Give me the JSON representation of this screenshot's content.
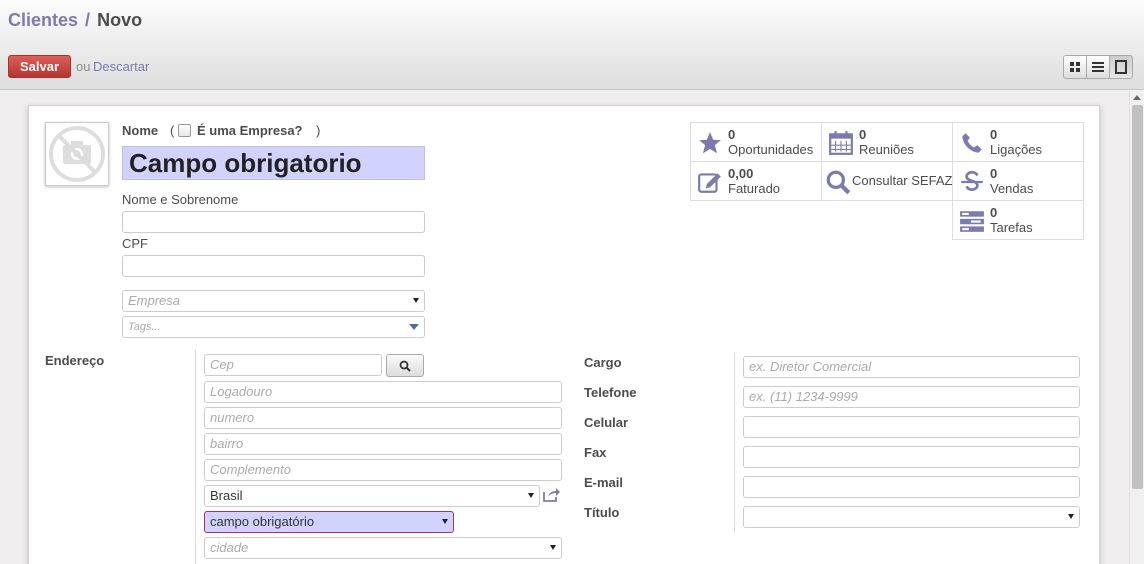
{
  "breadcrumb": {
    "parent": "Clientes",
    "separator": "/",
    "current": "Novo"
  },
  "actions": {
    "save": "Salvar",
    "or": "ou",
    "discard": "Descartar"
  },
  "header": {
    "name_label": "Nome",
    "company_open": "(",
    "company_label": "É uma Empresa?",
    "company_close": ")",
    "name_value": "Campo obrigatorio",
    "full_name_label": "Nome e Sobrenome",
    "full_name_value": "",
    "cpf_label": "CPF",
    "cpf_value": "",
    "company_placeholder": "Empresa",
    "tags_placeholder": "Tags..."
  },
  "stats": [
    {
      "icon": "star-icon",
      "value": "0",
      "label": "Oportunidades"
    },
    {
      "icon": "calendar-icon",
      "value": "0",
      "label": "Reuniões"
    },
    {
      "icon": "phone-icon",
      "value": "0",
      "label": "Ligações"
    },
    {
      "icon": "edit-icon",
      "value": "0,00",
      "label": "Faturado"
    },
    {
      "icon": "search-icon",
      "label": "Consultar SEFAZ"
    },
    {
      "icon": "strikethrough-icon",
      "value": "0",
      "label": "Vendas"
    },
    {
      "icon": "tasks-icon",
      "value": "0",
      "label": "Tarefas"
    }
  ],
  "address": {
    "label": "Endereço",
    "cep_placeholder": "Cep",
    "street_placeholder": "Logadouro",
    "number_placeholder": "numero",
    "district_placeholder": "bairro",
    "complement_placeholder": "Complemento",
    "country_value": "Brasil",
    "state_value": "campo obrigatório",
    "city_placeholder": "cidade"
  },
  "contact": {
    "job_label": "Cargo",
    "job_placeholder": "ex. Diretor Comercial",
    "phone_label": "Telefone",
    "phone_placeholder": "ex. (11) 1234-9999",
    "mobile_label": "Celular",
    "fax_label": "Fax",
    "email_label": "E-mail",
    "title_label": "Título"
  },
  "colors": {
    "accent": "#7c7bad",
    "save_button": "#c9413b",
    "required_bg": "#d2d2ff"
  }
}
